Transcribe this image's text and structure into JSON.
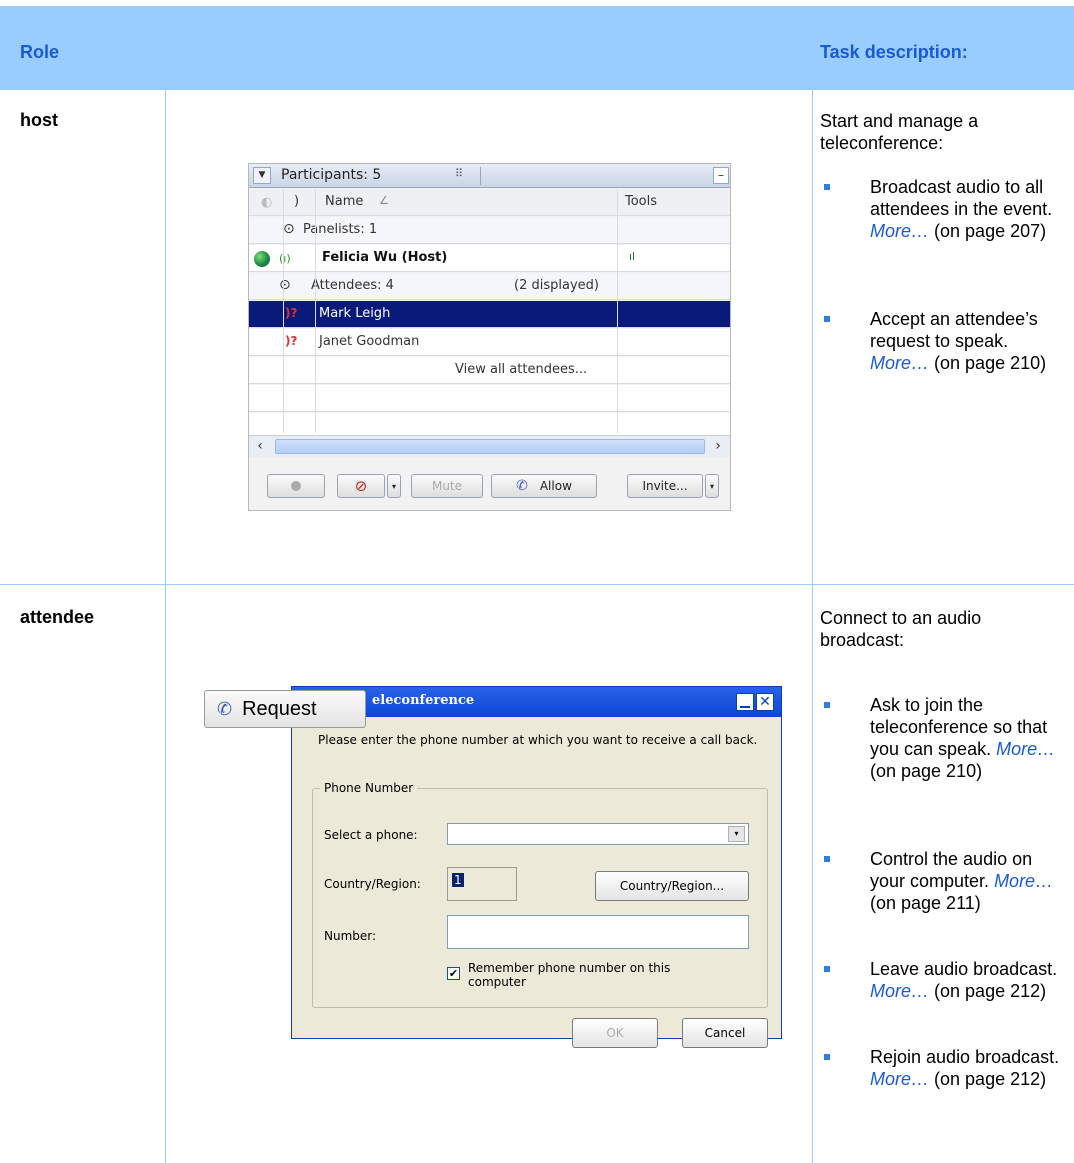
{
  "table": {
    "header": {
      "role": "Role",
      "task": "Task description:"
    },
    "rows": [
      {
        "role": "host",
        "intro": "Start and manage a teleconference:",
        "bullets": [
          {
            "text": "Broadcast audio to all attendees in the event. ",
            "link": "More…",
            "page": "(on page 207)"
          },
          {
            "text": "Accept an attendee’s request to speak. ",
            "link": "More…",
            "page": "(on page 210)"
          }
        ]
      },
      {
        "role": "attendee",
        "intro": "Connect to an audio broadcast:",
        "bullets": [
          {
            "text": "Ask to join the teleconference so that you can speak. ",
            "link": "More…",
            "page": "(on page 210)"
          },
          {
            "text": "Control the audio on your computer. ",
            "link": "More…",
            "page": "(on page 211)"
          },
          {
            "text": "Leave audio broadcast. ",
            "link": "More…",
            "page": "(on page 212)"
          },
          {
            "text": "Rejoin audio broadcast. ",
            "link": "More…",
            "page": "(on page 212)"
          }
        ]
      }
    ]
  },
  "participants": {
    "title": "Participants: 5",
    "col_name": "Name",
    "col_tools": "Tools",
    "panelists": "Panelists: 1",
    "host": "Felicia Wu (Host)",
    "attendees": "Attendees: 4",
    "displayed": "(2 displayed)",
    "attendee_rows": [
      "Mark Leigh",
      "Janet Goodman"
    ],
    "view_all": "View all attendees...",
    "buttons": {
      "mute": "Mute",
      "allow": "Allow",
      "invite": "Invite..."
    },
    "selection_color": "#0a1a7a"
  },
  "dialog": {
    "request": "Request",
    "title": "eleconference",
    "instructions": "Please enter the phone number at which you want to receive a call back.",
    "group": "Phone Number",
    "select_label": "Select a phone:",
    "select_value": "",
    "country_label": "Country/Region:",
    "country_value": "1",
    "country_button": "Country/Region...",
    "number_label": "Number:",
    "number_value": "",
    "remember": "Remember phone number on this computer",
    "remember_checked": true,
    "ok": "OK",
    "cancel": "Cancel"
  }
}
